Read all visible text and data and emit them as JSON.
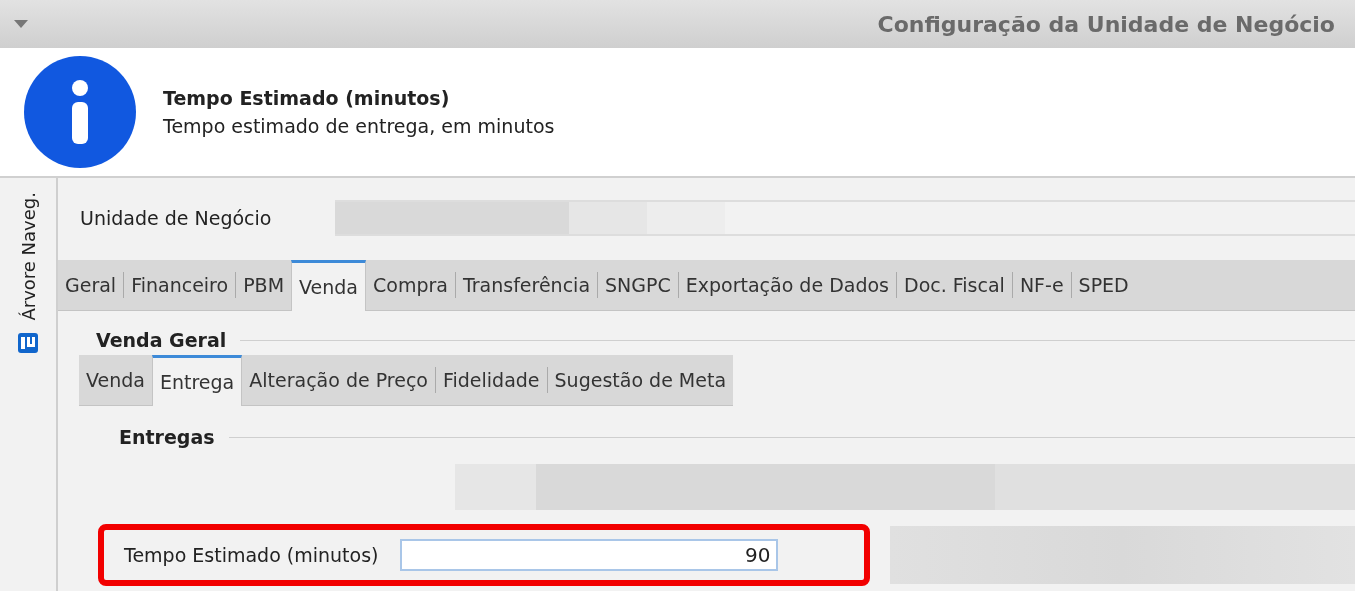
{
  "window": {
    "title": "Configuração da Unidade de Negócio"
  },
  "info": {
    "title": "Tempo Estimado (minutos)",
    "description": "Tempo estimado de entrega, em minutos"
  },
  "sidebar": {
    "label": "Árvore Naveg."
  },
  "business_unit": {
    "label": "Unidade de Negócio"
  },
  "tabs": [
    {
      "label": "Geral",
      "selected": false
    },
    {
      "label": "Financeiro",
      "selected": false
    },
    {
      "label": "PBM",
      "selected": false
    },
    {
      "label": "Venda",
      "selected": true
    },
    {
      "label": "Compra",
      "selected": false
    },
    {
      "label": "Transferência",
      "selected": false
    },
    {
      "label": "SNGPC",
      "selected": false
    },
    {
      "label": "Exportação de Dados",
      "selected": false
    },
    {
      "label": "Doc. Fiscal",
      "selected": false
    },
    {
      "label": "NF-e",
      "selected": false
    },
    {
      "label": "SPED",
      "selected": false
    }
  ],
  "group": {
    "title": "Venda Geral"
  },
  "subtabs": [
    {
      "label": "Venda",
      "selected": false
    },
    {
      "label": "Entrega",
      "selected": true
    },
    {
      "label": "Alteração de Preço",
      "selected": false
    },
    {
      "label": "Fidelidade",
      "selected": false
    },
    {
      "label": "Sugestão de Meta",
      "selected": false
    }
  ],
  "section": {
    "title": "Entregas"
  },
  "field": {
    "label": "Tempo Estimado (minutos)",
    "value": "90",
    "highlighted": true
  }
}
